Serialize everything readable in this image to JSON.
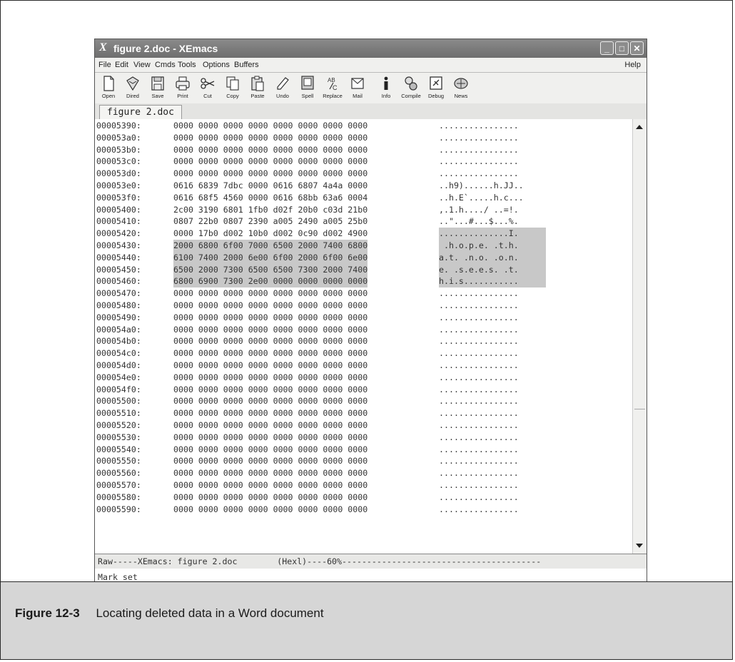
{
  "window": {
    "title_glyph": "X",
    "title": "figure 2.doc - XEmacs",
    "buttons": {
      "minimize": "_",
      "maximize": "□",
      "close": "✕"
    }
  },
  "menu": {
    "items": [
      "File",
      "Edit",
      "View",
      "Cmds",
      "Tools",
      "Options",
      "Buffers"
    ],
    "help": "Help"
  },
  "toolbar": {
    "buttons": [
      {
        "label": "Open",
        "icon": "open-icon"
      },
      {
        "label": "Dired",
        "icon": "dired-icon"
      },
      {
        "label": "Save",
        "icon": "save-icon"
      },
      {
        "label": "Print",
        "icon": "print-icon"
      },
      {
        "label": "Cut",
        "icon": "cut-icon"
      },
      {
        "label": "Copy",
        "icon": "copy-icon"
      },
      {
        "label": "Paste",
        "icon": "paste-icon"
      },
      {
        "label": "Undo",
        "icon": "undo-icon"
      },
      {
        "label": "Spell",
        "icon": "spell-icon"
      },
      {
        "label": "Replace",
        "icon": "replace-icon"
      },
      {
        "label": "Mail",
        "icon": "mail-icon"
      },
      {
        "label": "Info",
        "icon": "info-icon"
      },
      {
        "label": "Compile",
        "icon": "compile-icon"
      },
      {
        "label": "Debug",
        "icon": "debug-icon"
      },
      {
        "label": "News",
        "icon": "news-icon"
      }
    ]
  },
  "tab": {
    "label": "figure 2.doc"
  },
  "hex_rows": [
    {
      "addr": "00005390:",
      "hex": "0000 0000 0000 0000 0000 0000 0000 0000",
      "ascii": "................",
      "hl": false
    },
    {
      "addr": "000053a0:",
      "hex": "0000 0000 0000 0000 0000 0000 0000 0000",
      "ascii": "................",
      "hl": false
    },
    {
      "addr": "000053b0:",
      "hex": "0000 0000 0000 0000 0000 0000 0000 0000",
      "ascii": "................",
      "hl": false
    },
    {
      "addr": "000053c0:",
      "hex": "0000 0000 0000 0000 0000 0000 0000 0000",
      "ascii": "................",
      "hl": false
    },
    {
      "addr": "000053d0:",
      "hex": "0000 0000 0000 0000 0000 0000 0000 0000",
      "ascii": "................",
      "hl": false
    },
    {
      "addr": "000053e0:",
      "hex": "0616 6839 7dbc 0000 0616 6807 4a4a 0000",
      "ascii": "..h9)......h.JJ..",
      "hl": false
    },
    {
      "addr": "000053f0:",
      "hex": "0616 68f5 4560 0000 0616 68bb 63a6 0004",
      "ascii": "..h.E`.....h.c...",
      "hl": false
    },
    {
      "addr": "00005400:",
      "hex": "2c00 3190 6801 1fb0 d02f 20b0 c03d 21b0",
      "ascii": ",.1.h..../ ..=!.",
      "hl": false
    },
    {
      "addr": "00005410:",
      "hex": "0807 22b0 0807 2390 a005 2490 a005 25b0",
      "ascii": "..\"...#...$...%.",
      "hl": false
    },
    {
      "addr": "00005420:",
      "hex": "0000 17b0 d002 10b0 d002 0c90 d002 4900",
      "ascii": "..............I.",
      "hl": "ascii"
    },
    {
      "addr": "00005430:",
      "hex": "2000 6800 6f00 7000 6500 2000 7400 6800",
      "ascii": " .h.o.p.e. .t.h.",
      "hl": true
    },
    {
      "addr": "00005440:",
      "hex": "6100 7400 2000 6e00 6f00 2000 6f00 6e00",
      "ascii": "a.t. .n.o. .o.n.",
      "hl": true
    },
    {
      "addr": "00005450:",
      "hex": "6500 2000 7300 6500 6500 7300 2000 7400",
      "ascii": "e. .s.e.e.s. .t.",
      "hl": true
    },
    {
      "addr": "00005460:",
      "hex": "6800 6900 7300 2e00 0000 0000 0000 0000",
      "ascii": "h.i.s...........",
      "hl": true
    },
    {
      "addr": "00005470:",
      "hex": "0000 0000 0000 0000 0000 0000 0000 0000",
      "ascii": "................",
      "hl": false
    },
    {
      "addr": "00005480:",
      "hex": "0000 0000 0000 0000 0000 0000 0000 0000",
      "ascii": "................",
      "hl": false
    },
    {
      "addr": "00005490:",
      "hex": "0000 0000 0000 0000 0000 0000 0000 0000",
      "ascii": "................",
      "hl": false
    },
    {
      "addr": "000054a0:",
      "hex": "0000 0000 0000 0000 0000 0000 0000 0000",
      "ascii": "................",
      "hl": false
    },
    {
      "addr": "000054b0:",
      "hex": "0000 0000 0000 0000 0000 0000 0000 0000",
      "ascii": "................",
      "hl": false
    },
    {
      "addr": "000054c0:",
      "hex": "0000 0000 0000 0000 0000 0000 0000 0000",
      "ascii": "................",
      "hl": false
    },
    {
      "addr": "000054d0:",
      "hex": "0000 0000 0000 0000 0000 0000 0000 0000",
      "ascii": "................",
      "hl": false
    },
    {
      "addr": "000054e0:",
      "hex": "0000 0000 0000 0000 0000 0000 0000 0000",
      "ascii": "................",
      "hl": false
    },
    {
      "addr": "000054f0:",
      "hex": "0000 0000 0000 0000 0000 0000 0000 0000",
      "ascii": "................",
      "hl": false
    },
    {
      "addr": "00005500:",
      "hex": "0000 0000 0000 0000 0000 0000 0000 0000",
      "ascii": "................",
      "hl": false
    },
    {
      "addr": "00005510:",
      "hex": "0000 0000 0000 0000 0000 0000 0000 0000",
      "ascii": "................",
      "hl": false
    },
    {
      "addr": "00005520:",
      "hex": "0000 0000 0000 0000 0000 0000 0000 0000",
      "ascii": "................",
      "hl": false
    },
    {
      "addr": "00005530:",
      "hex": "0000 0000 0000 0000 0000 0000 0000 0000",
      "ascii": "................",
      "hl": false
    },
    {
      "addr": "00005540:",
      "hex": "0000 0000 0000 0000 0000 0000 0000 0000",
      "ascii": "................",
      "hl": false
    },
    {
      "addr": "00005550:",
      "hex": "0000 0000 0000 0000 0000 0000 0000 0000",
      "ascii": "................",
      "hl": false
    },
    {
      "addr": "00005560:",
      "hex": "0000 0000 0000 0000 0000 0000 0000 0000",
      "ascii": "................",
      "hl": false
    },
    {
      "addr": "00005570:",
      "hex": "0000 0000 0000 0000 0000 0000 0000 0000",
      "ascii": "................",
      "hl": false
    },
    {
      "addr": "00005580:",
      "hex": "0000 0000 0000 0000 0000 0000 0000 0000",
      "ascii": "................",
      "hl": false
    },
    {
      "addr": "00005590:",
      "hex": "0000 0000 0000 0000 0000 0000 0000 0000",
      "ascii": "................",
      "hl": false
    }
  ],
  "modeline": "Raw-----XEmacs: figure 2.doc        (Hexl)----60%----------------------------------------",
  "echo": "Mark set",
  "caption": {
    "number": "Figure 12-3",
    "text": "Locating deleted data in a Word document"
  },
  "colors": {
    "highlight": "#c8c8c8",
    "titlebar": "#7a7a7a",
    "caption_bg": "#d6d6d6"
  }
}
